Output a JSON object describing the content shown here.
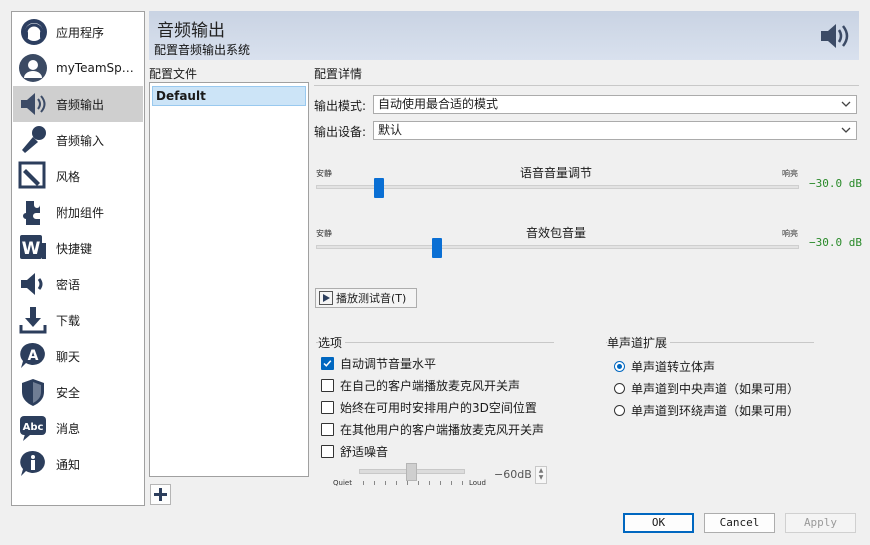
{
  "sidebar": {
    "items": [
      {
        "label": "应用程序",
        "icon": "app-icon"
      },
      {
        "label": "myTeamSpeak",
        "icon": "user-avatar-icon"
      },
      {
        "label": "音频输出",
        "icon": "speaker-icon",
        "active": true
      },
      {
        "label": "音频输入",
        "icon": "microphone-icon"
      },
      {
        "label": "风格",
        "icon": "pen-icon"
      },
      {
        "label": "附加组件",
        "icon": "puzzle-icon"
      },
      {
        "label": "快捷键",
        "icon": "keyboard-w-icon"
      },
      {
        "label": "密语",
        "icon": "whisper-speaker-icon"
      },
      {
        "label": "下载",
        "icon": "download-icon"
      },
      {
        "label": "聊天",
        "icon": "chat-icon"
      },
      {
        "label": "安全",
        "icon": "shield-icon"
      },
      {
        "label": "消息",
        "icon": "message-abc-icon"
      },
      {
        "label": "通知",
        "icon": "info-icon"
      }
    ]
  },
  "banner": {
    "title": "音频输出",
    "subtitle": "配置音频输出系统",
    "icon": "speaker-icon"
  },
  "profiles": {
    "label": "配置文件",
    "items": [
      "Default"
    ]
  },
  "details": {
    "label": "配置详情",
    "output_mode_label": "输出模式:",
    "output_mode_value": "自动使用最合适的模式",
    "output_device_label": "输出设备:",
    "output_device_value": "默认",
    "voice_volume": {
      "title": "语音音量调节",
      "min_label": "安静",
      "max_label": "响亮",
      "db": "−30.0 dB",
      "position": 0.13
    },
    "sound_volume": {
      "title": "音效包音量",
      "min_label": "安静",
      "max_label": "响亮",
      "db": "−30.0 dB",
      "position": 0.25
    },
    "play_test_label": "播放测试音(T)"
  },
  "options": {
    "title": "选项",
    "items": [
      {
        "label": "自动调节音量水平",
        "checked": true
      },
      {
        "label": "在自己的客户端播放麦克风开关声",
        "checked": false
      },
      {
        "label": "始终在可用时安排用户的3D空间位置",
        "checked": false
      },
      {
        "label": "在其他用户的客户端播放麦克风开关声",
        "checked": false
      },
      {
        "label": "舒适噪音",
        "checked": false
      }
    ],
    "comfort_noise": {
      "quiet_label": "Quiet",
      "loud_label": "Loud",
      "db": "−60dB"
    }
  },
  "mono": {
    "title": "单声道扩展",
    "items": [
      {
        "label": "单声道转立体声",
        "selected": true
      },
      {
        "label": "单声道到中央声道（如果可用）",
        "selected": false
      },
      {
        "label": "单声道到环绕声道（如果可用）",
        "selected": false
      }
    ]
  },
  "buttons": {
    "ok": "OK",
    "cancel": "Cancel",
    "apply": "Apply"
  },
  "colors": {
    "accent": "#0067c0",
    "db_green": "#2a8a2a",
    "banner": "#c9d3e3"
  }
}
